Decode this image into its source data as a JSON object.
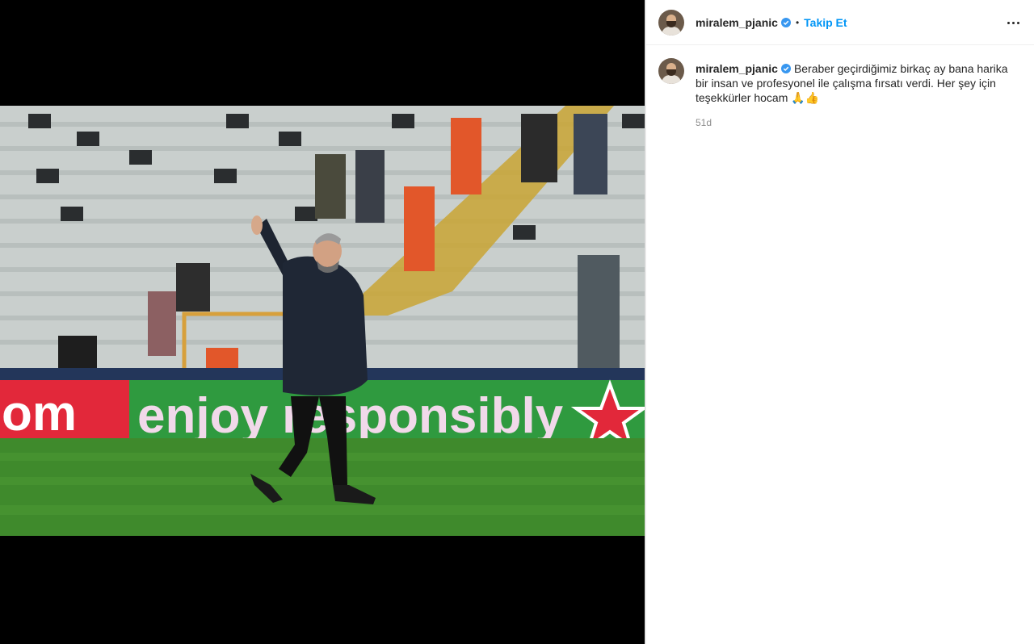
{
  "post": {
    "author": {
      "username": "miralem_pjanic",
      "verified": true,
      "follow_label": "Takip Et",
      "separator": "•"
    },
    "caption": {
      "text": "Beraber geçirdiğimiz birkaç ay bana harika bir insan ve profesyonel ile çalışma fırsatı verdi. Her şey için teşekkürler hocam",
      "emojis": "🙏👍",
      "age": "51d"
    },
    "media": {
      "banner_left": "om",
      "banner_text": "enjoy responsibly"
    }
  },
  "colors": {
    "accent": "#0095f6",
    "verified": "#3897f0",
    "text": "#262626",
    "muted": "#8e8e8e"
  },
  "icons": [
    "verified-badge-icon",
    "more-options-icon"
  ]
}
